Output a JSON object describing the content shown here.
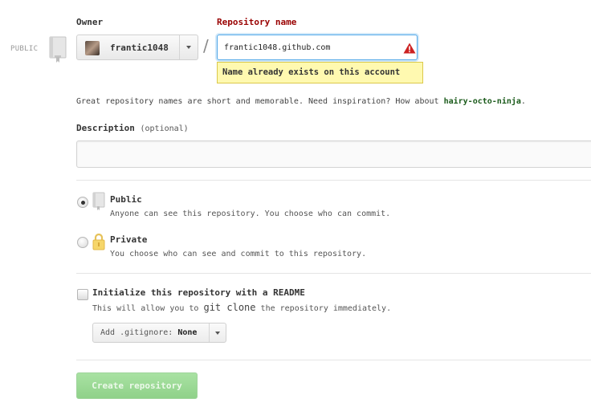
{
  "owner": {
    "label": "Owner",
    "name": "frantic1048",
    "visibility_tag": "PUBLIC"
  },
  "repo": {
    "label": "Repository name",
    "value": "frantic1048.github.com",
    "error": "Name already exists on this account"
  },
  "hint": {
    "text": "Great repository names are short and memorable. Need inspiration? How about",
    "suggestion": "hairy-octo-ninja",
    "suffix": "."
  },
  "description": {
    "label": "Description",
    "optional": "(optional)",
    "value": ""
  },
  "visibility": {
    "selected": "public",
    "public": {
      "title": "Public",
      "desc": "Anyone can see this repository. You choose who can commit."
    },
    "private": {
      "title": "Private",
      "desc": "You choose who can see and commit to this repository."
    }
  },
  "readme": {
    "checked": false,
    "title": "Initialize this repository with a README",
    "desc_pre": "This will allow you to",
    "desc_code": "git clone",
    "desc_post": "the repository immediately."
  },
  "gitignore": {
    "label": "Add .gitignore:",
    "value": "None"
  },
  "submit": {
    "label": "Create repository"
  },
  "colors": {
    "error_label": "#990000",
    "error_bg": "#fff9b0",
    "suggestion": "#1a5a1a",
    "create_button": "#9bd896",
    "warning": "#cc2222",
    "lock": "#f0c040"
  },
  "icons": {
    "repo": "book-icon",
    "warning": "warning-triangle-icon",
    "public": "book-icon",
    "private": "lock-icon"
  }
}
